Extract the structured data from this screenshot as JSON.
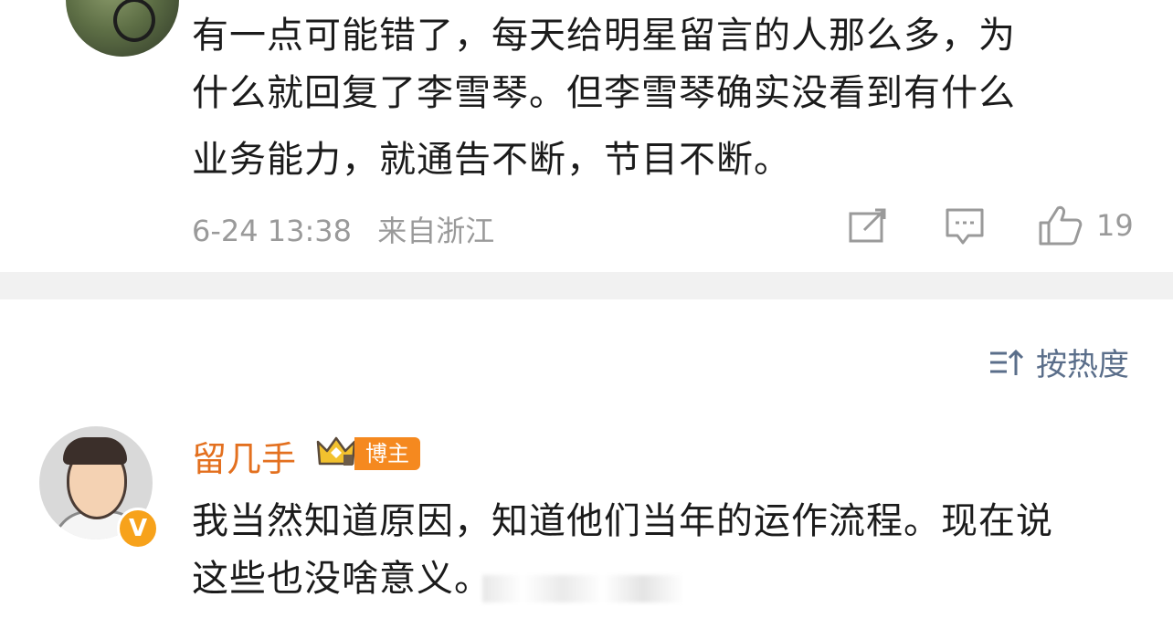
{
  "top_comment": {
    "lines": [
      "有一点可能错了，每天给明星留言的人那么多，为",
      "什么就回复了李雪琴。但李雪琴确实没看到有什么",
      "业务能力，就通告不断，节目不断。"
    ],
    "date": "6-24 13:38",
    "location": "来自浙江",
    "like_count": "19",
    "icons": [
      "share-icon",
      "comment-icon",
      "like-icon"
    ]
  },
  "sort": {
    "label": "按热度",
    "icon": "sort-icon"
  },
  "reply": {
    "username": "留几手",
    "badge": "博主",
    "verified_mark": "V",
    "lines": [
      "我当然知道原因，知道他们当年的运作流程。现在说",
      "这些也没啥意义。"
    ],
    "colors": {
      "username": "#e3701f",
      "badge": "#f5891f",
      "verified": "#f7a21b"
    }
  }
}
